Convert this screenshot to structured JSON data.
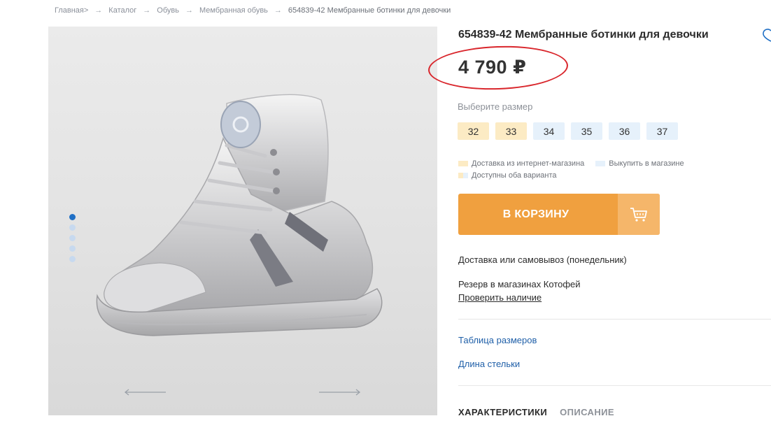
{
  "breadcrumb": {
    "items": [
      "Главная>",
      "Каталог",
      "Обувь",
      "Мембранная обувь",
      "654839-42 Мембранные ботинки для девочки"
    ]
  },
  "gallery": {
    "slides_count": 5,
    "active_slide": 1
  },
  "product": {
    "title": "654839-42 Мембранные ботинки для девочки",
    "price": "4 790 ₽"
  },
  "sizes": {
    "label": "Выберите размер",
    "items": [
      {
        "value": "32",
        "availability": "online"
      },
      {
        "value": "33",
        "availability": "online"
      },
      {
        "value": "34",
        "availability": "store"
      },
      {
        "value": "35",
        "availability": "store"
      },
      {
        "value": "36",
        "availability": "store"
      },
      {
        "value": "37",
        "availability": "store"
      }
    ]
  },
  "legend": {
    "online": "Доставка из интернет-магазина",
    "store": "Выкупить в магазине",
    "both": "Доступны оба варианта"
  },
  "cart": {
    "label": "В КОРЗИНУ",
    "icon": "cart-icon"
  },
  "info": {
    "delivery": "Доставка или самовывоз (понедельник)",
    "reserve": "Резерв в магазинах Котофей",
    "check_link": "Проверить наличие",
    "size_table_link": "Таблица размеров",
    "insole_link": "Длина стельки"
  },
  "tabs": [
    "ХАРАКТЕРИСТИКИ",
    "ОПИСАНИЕ"
  ],
  "colors": {
    "accent_orange": "#f0a03f",
    "link_blue": "#1f5fa8",
    "online_bg": "#fcebc4",
    "store_bg": "#e6f1fb",
    "annotation_red": "#d9262c"
  }
}
